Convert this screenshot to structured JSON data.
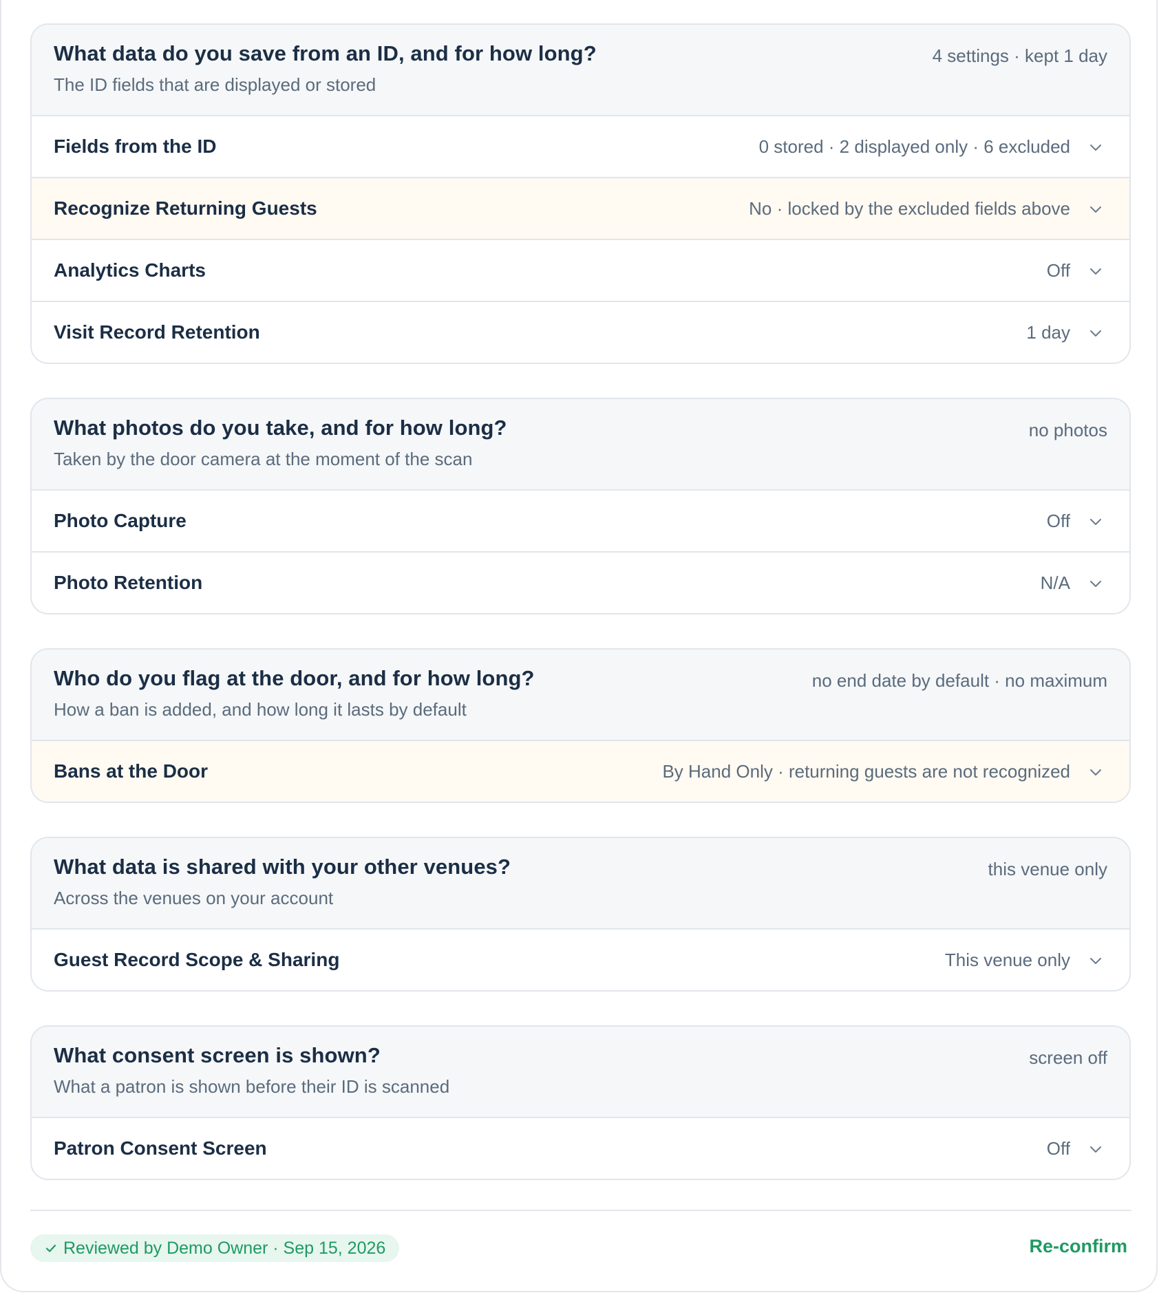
{
  "sections": [
    {
      "title": "What data do you save from an ID, and for how long?",
      "subtitle": "The ID fields that are displayed or stored",
      "summary": "4 settings · kept 1 day",
      "rows": [
        {
          "label": "Fields from the ID",
          "value": "0 stored · 2 displayed only · 6 excluded"
        },
        {
          "label": "Recognize Returning Guests",
          "value": "No · locked by the excluded fields above"
        },
        {
          "label": "Analytics Charts",
          "value": "Off"
        },
        {
          "label": "Visit Record Retention",
          "value": "1 day"
        }
      ]
    },
    {
      "title": "What photos do you take, and for how long?",
      "subtitle": "Taken by the door camera at the moment of the scan",
      "summary": "no photos",
      "rows": [
        {
          "label": "Photo Capture",
          "value": "Off"
        },
        {
          "label": "Photo Retention",
          "value": "N/A"
        }
      ]
    },
    {
      "title": "Who do you flag at the door, and for how long?",
      "subtitle": "How a ban is added, and how long it lasts by default",
      "summary": "no end date by default · no maximum",
      "rows": [
        {
          "label": "Bans at the Door",
          "value": "By Hand Only · returning guests are not recognized"
        }
      ]
    },
    {
      "title": "What data is shared with your other venues?",
      "subtitle": "Across the venues on your account",
      "summary": "this venue only",
      "rows": [
        {
          "label": "Guest Record Scope & Sharing",
          "value": "This venue only"
        }
      ]
    },
    {
      "title": "What consent screen is shown?",
      "subtitle": "What a patron is shown before their ID is scanned",
      "summary": "screen off",
      "rows": [
        {
          "label": "Patron Consent Screen",
          "value": "Off"
        }
      ]
    }
  ],
  "footer": {
    "reviewed_text": "Reviewed by Demo Owner · Sep 15, 2026",
    "reconfirm_label": "Re-confirm"
  },
  "colors": {
    "accent_green": "#1f9a63",
    "warning_row_bg": "#fffaf2",
    "header_bg": "#f5f7f9"
  },
  "icons": {
    "row_toggle": "chevron-down-icon",
    "badge": "check-icon"
  }
}
